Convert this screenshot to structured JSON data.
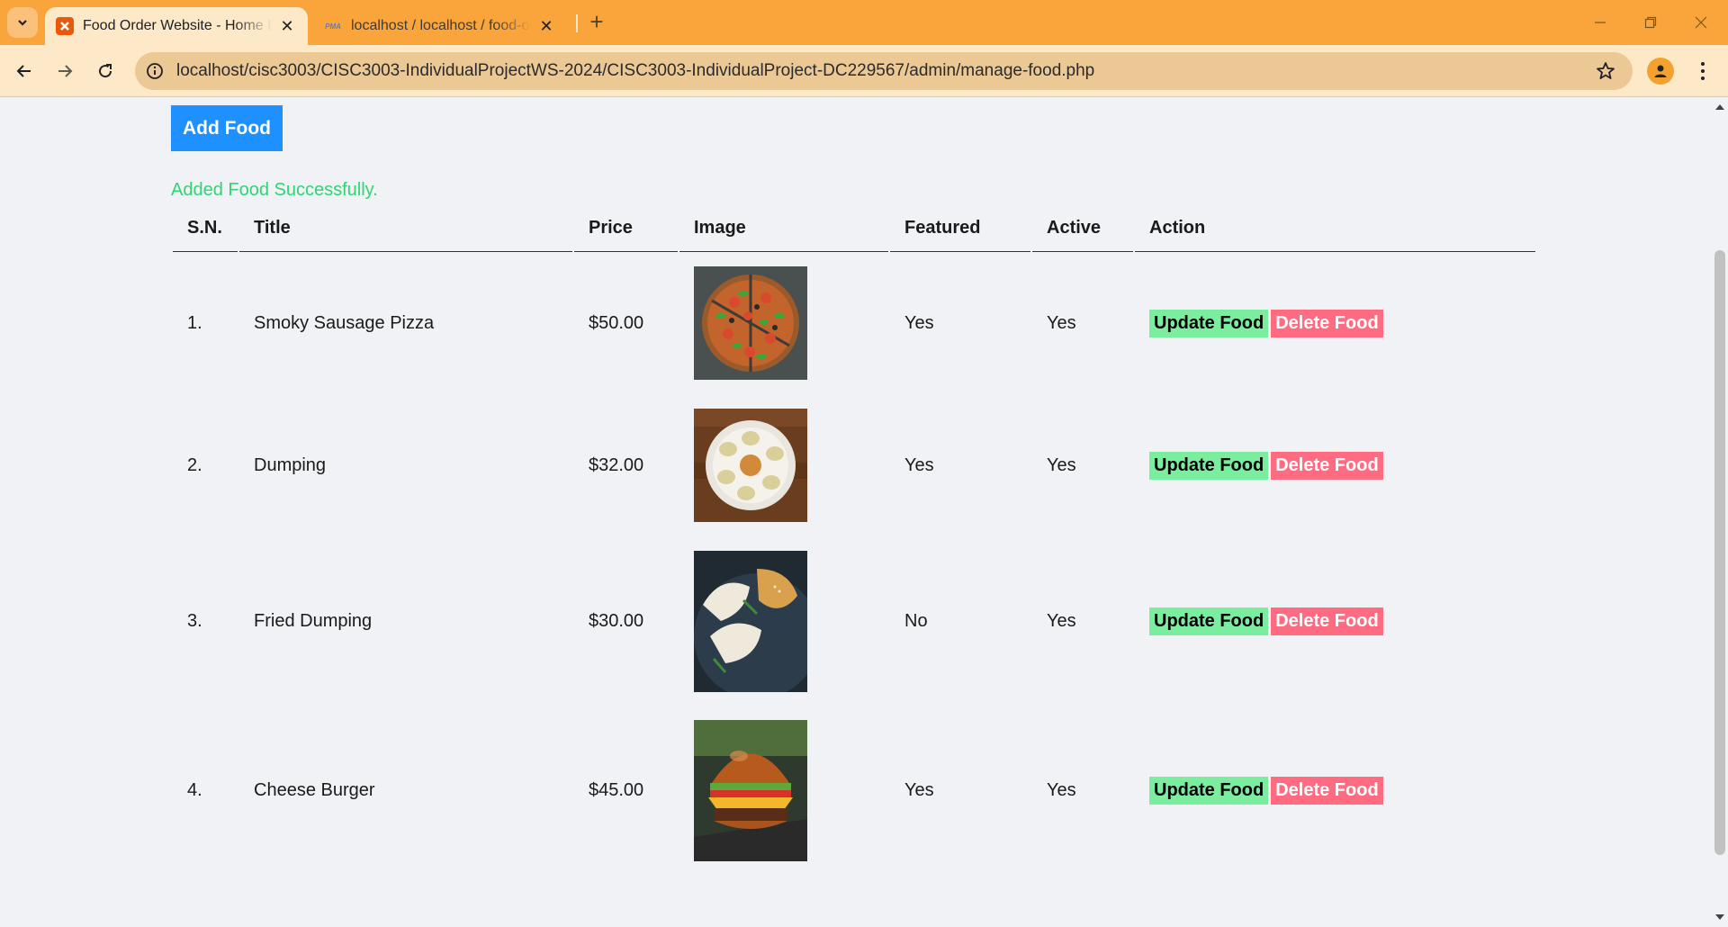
{
  "browser": {
    "tabs": [
      {
        "title": "Food Order Website - Home Page",
        "active": true
      },
      {
        "title": "localhost / localhost / food-order",
        "active": false
      }
    ],
    "pma_label": "PMA",
    "url": "localhost/cisc3003/CISC3003-IndividualProjectWS-2024/CISC3003-IndividualProject-DC229567/admin/manage-food.php",
    "accent_color": "#f9a53b"
  },
  "page": {
    "add_button": "Add Food",
    "success_message": "Added Food Successfully.",
    "table": {
      "headers": [
        "S.N.",
        "Title",
        "Price",
        "Image",
        "Featured",
        "Active",
        "Action"
      ],
      "rows": [
        {
          "sn": "1.",
          "title": "Smoky Sausage Pizza",
          "price": "$50.00",
          "image": "pizza",
          "featured": "Yes",
          "active": "Yes"
        },
        {
          "sn": "2.",
          "title": "Dumping",
          "price": "$32.00",
          "image": "dumplings-plate",
          "featured": "Yes",
          "active": "Yes"
        },
        {
          "sn": "3.",
          "title": "Fried Dumping",
          "price": "$30.00",
          "image": "fried-dumplings",
          "featured": "No",
          "active": "Yes"
        },
        {
          "sn": "4.",
          "title": "Cheese Burger",
          "price": "$45.00",
          "image": "cheese-burger",
          "featured": "Yes",
          "active": "Yes"
        }
      ],
      "update_label": "Update Food",
      "delete_label": "Delete Food"
    }
  }
}
